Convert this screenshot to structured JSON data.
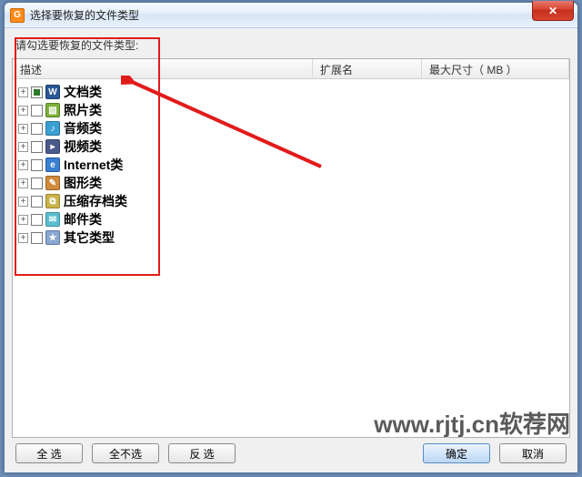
{
  "window": {
    "title": "选择要恢复的文件类型",
    "close_glyph": "✕"
  },
  "instruction": "请勾选要恢复的文件类型:",
  "columns": {
    "desc": "描述",
    "ext": "扩展名",
    "size": "最大尺寸（ MB ）"
  },
  "categories": [
    {
      "label": "文档类",
      "icon": "doc",
      "glyph": "W",
      "checked": true
    },
    {
      "label": "照片类",
      "icon": "photo",
      "glyph": "▧",
      "checked": false
    },
    {
      "label": "音频类",
      "icon": "audio",
      "glyph": "♪",
      "checked": false
    },
    {
      "label": "视频类",
      "icon": "video",
      "glyph": "▸",
      "checked": false
    },
    {
      "label": "Internet类",
      "icon": "net",
      "glyph": "e",
      "checked": false
    },
    {
      "label": "图形类",
      "icon": "graph",
      "glyph": "✎",
      "checked": false
    },
    {
      "label": "压缩存档类",
      "icon": "zip",
      "glyph": "⧉",
      "checked": false
    },
    {
      "label": "邮件类",
      "icon": "mail",
      "glyph": "✉",
      "checked": false
    },
    {
      "label": "其它类型",
      "icon": "other",
      "glyph": "★",
      "checked": false
    }
  ],
  "buttons": {
    "select_all": "全  选",
    "select_none": "全不选",
    "invert": "反    选",
    "ok": "确定",
    "cancel": "取消"
  },
  "watermark": "www.rjtj.cn软荐网"
}
